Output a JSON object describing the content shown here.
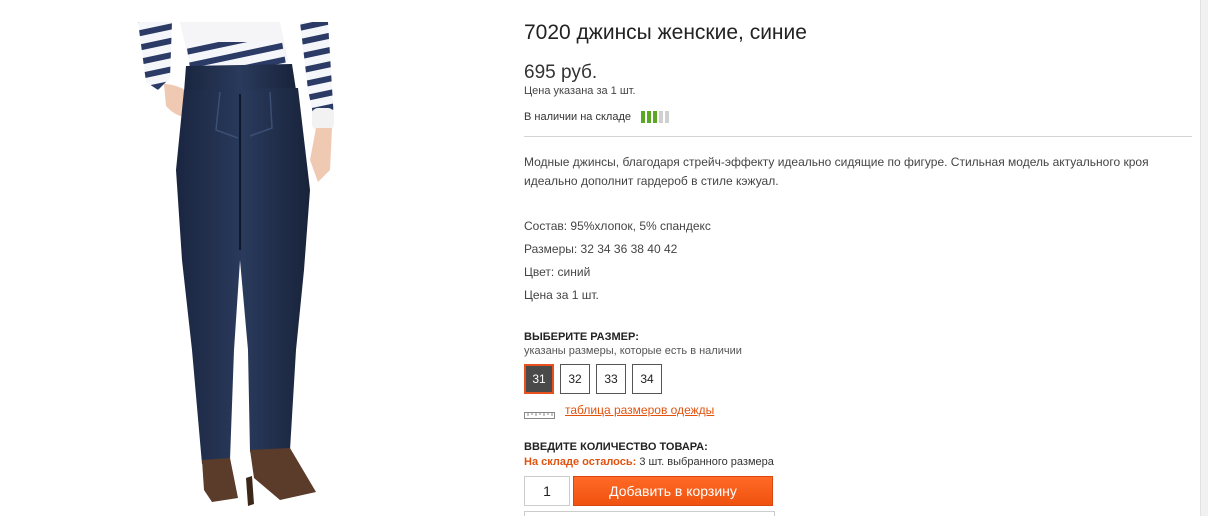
{
  "product": {
    "title": "7020 джинсы женские, синие",
    "price": "695 руб.",
    "price_note": "Цена указана за 1 шт.",
    "availability_label": "В наличии на складе",
    "availability_level": 3,
    "availability_max": 5,
    "description": "Модные джинсы, благодаря стрейч-эффекту идеально сидящие по фигуре. Стильная модель актуального кроя идеально дополнит гардероб в стиле кэжуал.",
    "specs": {
      "composition": "Состав: 95%хлопок, 5% спандекс",
      "sizes": "Размеры: 32 34 36 38 40 42",
      "color": "Цвет: синий",
      "price_per": "Цена за 1 шт."
    }
  },
  "size_picker": {
    "heading": "ВЫБЕРИТЕ РАЗМЕР:",
    "note": "указаны размеры, которые есть в наличии",
    "options": [
      "31",
      "32",
      "33",
      "34"
    ],
    "selected": "31",
    "size_table_link": "таблица размеров одежды"
  },
  "quantity": {
    "heading": "ВВЕДИТЕ КОЛИЧЕСТВО ТОВАРА:",
    "stock_warning_label": "На складе осталось:",
    "stock_warning_value": "3 шт. выбранного размера",
    "value": "1",
    "add_to_cart_label": "Добавить в корзину"
  },
  "colors": {
    "accent": "#e2520f",
    "button": "#f15a14",
    "stock_bar_on": "#5aa824",
    "stock_bar_off": "#d0d0d0",
    "jeans": "#1f2d4a",
    "shoes": "#5b3b2a"
  },
  "icons": {
    "ruler": "ruler-icon"
  }
}
